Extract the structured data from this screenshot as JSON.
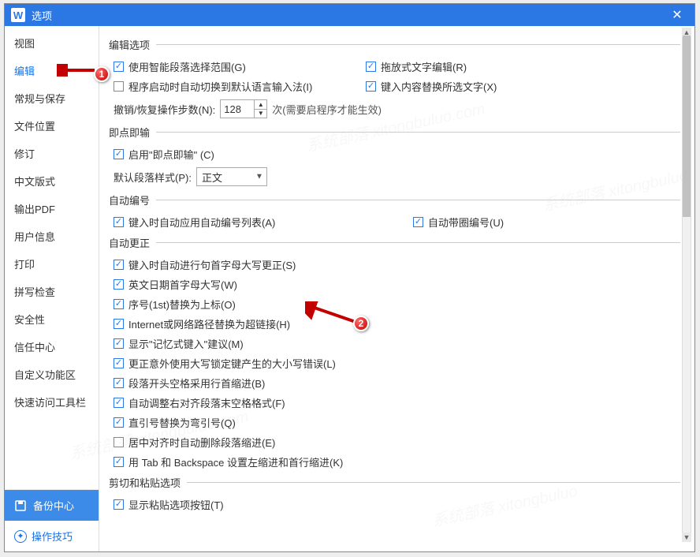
{
  "window": {
    "title": "选项"
  },
  "annotations": {
    "badge1": "1",
    "badge2": "2"
  },
  "sidebar": {
    "items": [
      "视图",
      "编辑",
      "常规与保存",
      "文件位置",
      "修订",
      "中文版式",
      "输出PDF",
      "用户信息",
      "打印",
      "拼写检查",
      "安全性",
      "信任中心",
      "自定义功能区",
      "快速访问工具栏"
    ],
    "active_index": 1,
    "backup_label": "备份中心",
    "tips_label": "操作技巧"
  },
  "sections": {
    "edit_options": {
      "title": "编辑选项",
      "left": [
        {
          "checked": true,
          "label": "使用智能段落选择范围(G)"
        },
        {
          "checked": false,
          "label": "程序启动时自动切换到默认语言输入法(I)"
        }
      ],
      "right": [
        {
          "checked": true,
          "label": "拖放式文字编辑(R)"
        },
        {
          "checked": true,
          "label": "键入内容替换所选文字(X)"
        }
      ],
      "undo_label": "撤销/恢复操作步数(N):",
      "undo_value": "128",
      "undo_hint": "次(需要启程序才能生效)"
    },
    "click_type": {
      "title": "即点即输",
      "enable": {
        "checked": true,
        "label": "启用\"即点即输\" (C)"
      },
      "style_label": "默认段落样式(P):",
      "style_value": "正文"
    },
    "auto_number": {
      "title": "自动编号",
      "left": {
        "checked": true,
        "label": "键入时自动应用自动编号列表(A)"
      },
      "right": {
        "checked": true,
        "label": "自动带圈编号(U)"
      }
    },
    "auto_correct": {
      "title": "自动更正",
      "items": [
        {
          "checked": true,
          "label": "键入时自动进行句首字母大写更正(S)"
        },
        {
          "checked": true,
          "label": "英文日期首字母大写(W)"
        },
        {
          "checked": true,
          "label": "序号(1st)替换为上标(O)"
        },
        {
          "checked": true,
          "label": "Internet或网络路径替换为超链接(H)"
        },
        {
          "checked": true,
          "label": "显示\"记忆式键入\"建议(M)"
        },
        {
          "checked": true,
          "label": "更正意外使用大写锁定键产生的大小写错误(L)"
        },
        {
          "checked": true,
          "label": "段落开头空格采用行首缩进(B)"
        },
        {
          "checked": true,
          "label": "自动调整右对齐段落末空格格式(F)"
        },
        {
          "checked": true,
          "label": "直引号替换为弯引号(Q)"
        },
        {
          "checked": false,
          "label": "居中对齐时自动删除段落缩进(E)"
        },
        {
          "checked": true,
          "label": "用 Tab 和 Backspace 设置左缩进和首行缩进(K)"
        }
      ]
    },
    "cut_paste": {
      "title": "剪切和粘贴选项",
      "items": [
        {
          "checked": true,
          "label": "显示粘贴选项按钮(T)"
        }
      ]
    }
  }
}
